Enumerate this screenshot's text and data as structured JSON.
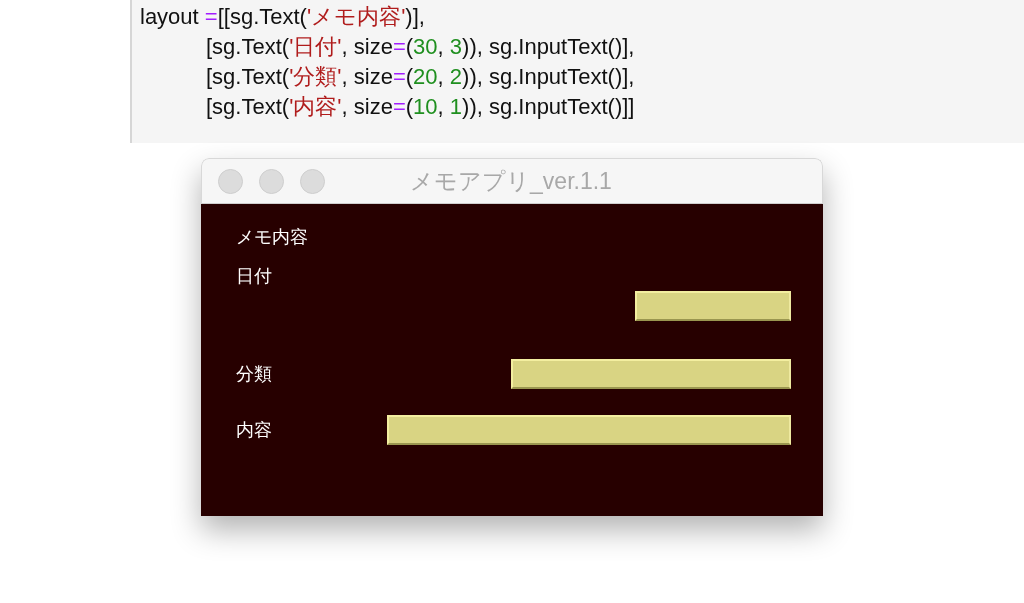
{
  "code": {
    "lines": [
      [
        {
          "kind": "plain",
          "text": "layout "
        },
        {
          "kind": "op",
          "text": "="
        },
        {
          "kind": "plain",
          "text": "[[sg.Text("
        },
        {
          "kind": "str",
          "text": "'メモ内容'"
        },
        {
          "kind": "plain",
          "text": ")],"
        }
      ],
      [
        {
          "kind": "plain",
          "text": "[sg.Text("
        },
        {
          "kind": "str",
          "text": "'日付'"
        },
        {
          "kind": "plain",
          "text": ", size"
        },
        {
          "kind": "op",
          "text": "="
        },
        {
          "kind": "plain",
          "text": "("
        },
        {
          "kind": "num",
          "text": "30"
        },
        {
          "kind": "plain",
          "text": ", "
        },
        {
          "kind": "num",
          "text": "3"
        },
        {
          "kind": "plain",
          "text": ")), sg.InputText()],"
        }
      ],
      [
        {
          "kind": "plain",
          "text": "[sg.Text("
        },
        {
          "kind": "str",
          "text": "'分類'"
        },
        {
          "kind": "plain",
          "text": ", size"
        },
        {
          "kind": "op",
          "text": "="
        },
        {
          "kind": "plain",
          "text": "("
        },
        {
          "kind": "num",
          "text": "20"
        },
        {
          "kind": "plain",
          "text": ", "
        },
        {
          "kind": "num",
          "text": "2"
        },
        {
          "kind": "plain",
          "text": ")), sg.InputText()],"
        }
      ],
      [
        {
          "kind": "plain",
          "text": "[sg.Text("
        },
        {
          "kind": "str",
          "text": "'内容'"
        },
        {
          "kind": "plain",
          "text": ", size"
        },
        {
          "kind": "op",
          "text": "="
        },
        {
          "kind": "plain",
          "text": "("
        },
        {
          "kind": "num",
          "text": "10"
        },
        {
          "kind": "plain",
          "text": ", "
        },
        {
          "kind": "num",
          "text": "1"
        },
        {
          "kind": "plain",
          "text": ")), sg.InputText()]]"
        }
      ]
    ]
  },
  "window": {
    "title": "メモアプリ_ver.1.1",
    "heading": "メモ内容",
    "rows": [
      {
        "label": "日付"
      },
      {
        "label": "分類"
      },
      {
        "label": "内容"
      }
    ]
  }
}
